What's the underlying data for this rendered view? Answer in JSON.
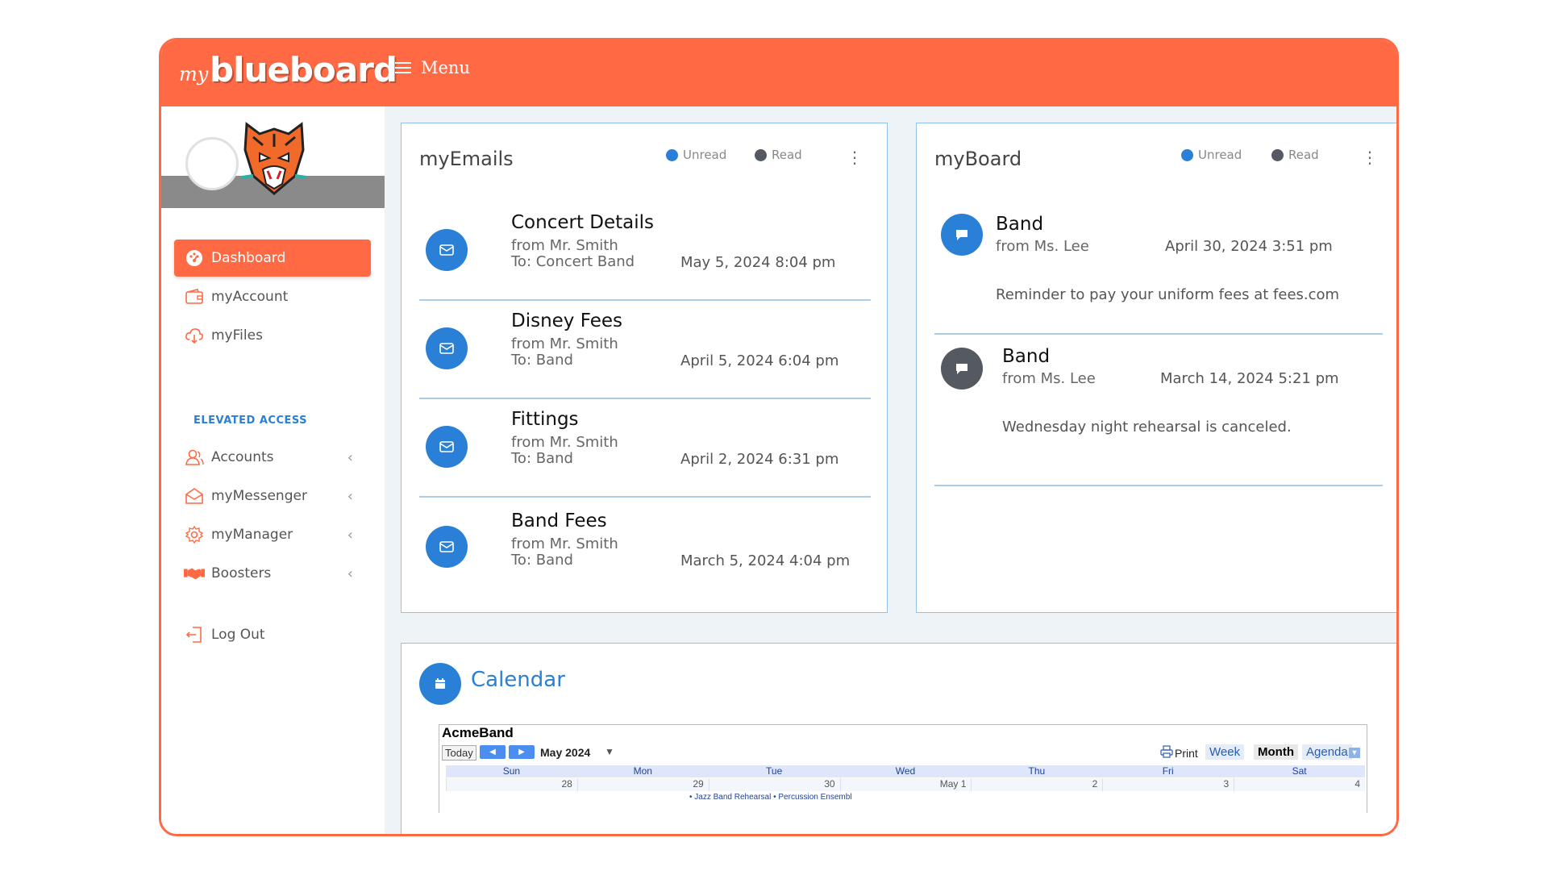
{
  "app": {
    "logo_my": "my",
    "logo_name": "blueboard",
    "menu_label": "Menu"
  },
  "colors": {
    "brand": "#ff6a45",
    "accent": "#2a7fd6",
    "unread": "#2a7fd6",
    "read": "#555a60"
  },
  "sidebar": {
    "items": [
      {
        "label": "Dashboard",
        "icon": "dashboard-icon"
      },
      {
        "label": "myAccount",
        "icon": "wallet-icon"
      },
      {
        "label": "myFiles",
        "icon": "cloud-download-icon"
      }
    ],
    "section_label": "ELEVATED ACCESS",
    "elevated": [
      {
        "label": "Accounts",
        "icon": "users-icon"
      },
      {
        "label": "myMessenger",
        "icon": "envelope-open-icon"
      },
      {
        "label": "myManager",
        "icon": "gear-icon"
      },
      {
        "label": "Boosters",
        "icon": "handshake-icon"
      }
    ],
    "logout": "Log Out"
  },
  "emails": {
    "title": "myEmails",
    "legend_unread": "Unread",
    "legend_read": "Read",
    "items": [
      {
        "subject": "Concert Details",
        "from": "from Mr. Smith",
        "to": "To: Concert Band",
        "date": "May 5, 2024 8:04 pm"
      },
      {
        "subject": "Disney Fees",
        "from": "from Mr. Smith",
        "to": "To: Band",
        "date": "April 5, 2024 6:04 pm"
      },
      {
        "subject": "Fittings",
        "from": "from Mr. Smith",
        "to": "To: Band",
        "date": "April 2, 2024 6:31 pm"
      },
      {
        "subject": "Band Fees",
        "from": "from Mr. Smith",
        "to": "To: Band",
        "date": "March 5, 2024 4:04 pm"
      }
    ]
  },
  "board": {
    "title": "myBoard",
    "legend_unread": "Unread",
    "legend_read": "Read",
    "items": [
      {
        "title": "Band",
        "from": "from Ms. Lee",
        "date": "April 30, 2024 3:51 pm",
        "message": "Reminder to pay your uniform fees at fees.com",
        "status": "unread"
      },
      {
        "title": "Band",
        "from": "from Ms. Lee",
        "date": "March 14, 2024 5:21 pm",
        "message": "Wednesday night rehearsal is canceled.",
        "status": "read"
      }
    ]
  },
  "calendar": {
    "title": "Calendar",
    "name": "AcmeBand",
    "today": "Today",
    "month": "May 2024",
    "print": "Print",
    "views": [
      "Week",
      "Month",
      "Agenda"
    ],
    "selected_view": "Month",
    "days": [
      "Sun",
      "Mon",
      "Tue",
      "Wed",
      "Thu",
      "Fri",
      "Sat"
    ],
    "dates": [
      "28",
      "29",
      "30",
      "May 1",
      "2",
      "3",
      "4"
    ],
    "events": "• Jazz Band Rehearsal  • Percussion Ensembl"
  }
}
